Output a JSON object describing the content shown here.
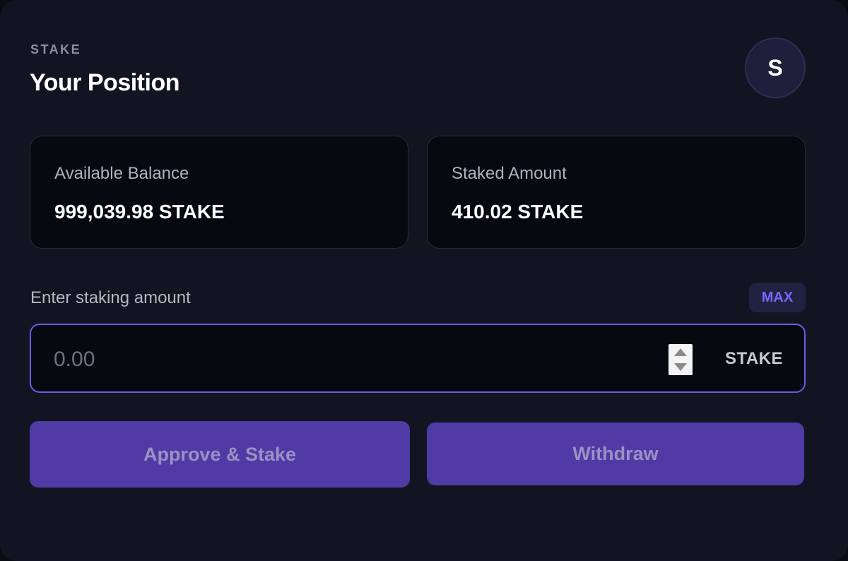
{
  "header": {
    "eyebrow": "STAKE",
    "title": "Your Position",
    "avatar_letter": "S"
  },
  "stats": {
    "available": {
      "label": "Available Balance",
      "value": "999,039.98 STAKE"
    },
    "staked": {
      "label": "Staked Amount",
      "value": "410.02 STAKE"
    }
  },
  "amount": {
    "label": "Enter staking amount",
    "max_label": "MAX",
    "placeholder": "0.00",
    "value": "",
    "unit": "STAKE"
  },
  "actions": {
    "approve_label": "Approve & Stake",
    "withdraw_label": "Withdraw"
  },
  "colors": {
    "accent": "#6d5ae6",
    "button_bg": "#4f3aa6",
    "max_text": "#7b66ff",
    "card_bg": "#121521"
  },
  "icons": {
    "spinner": "number-stepper-icon"
  }
}
